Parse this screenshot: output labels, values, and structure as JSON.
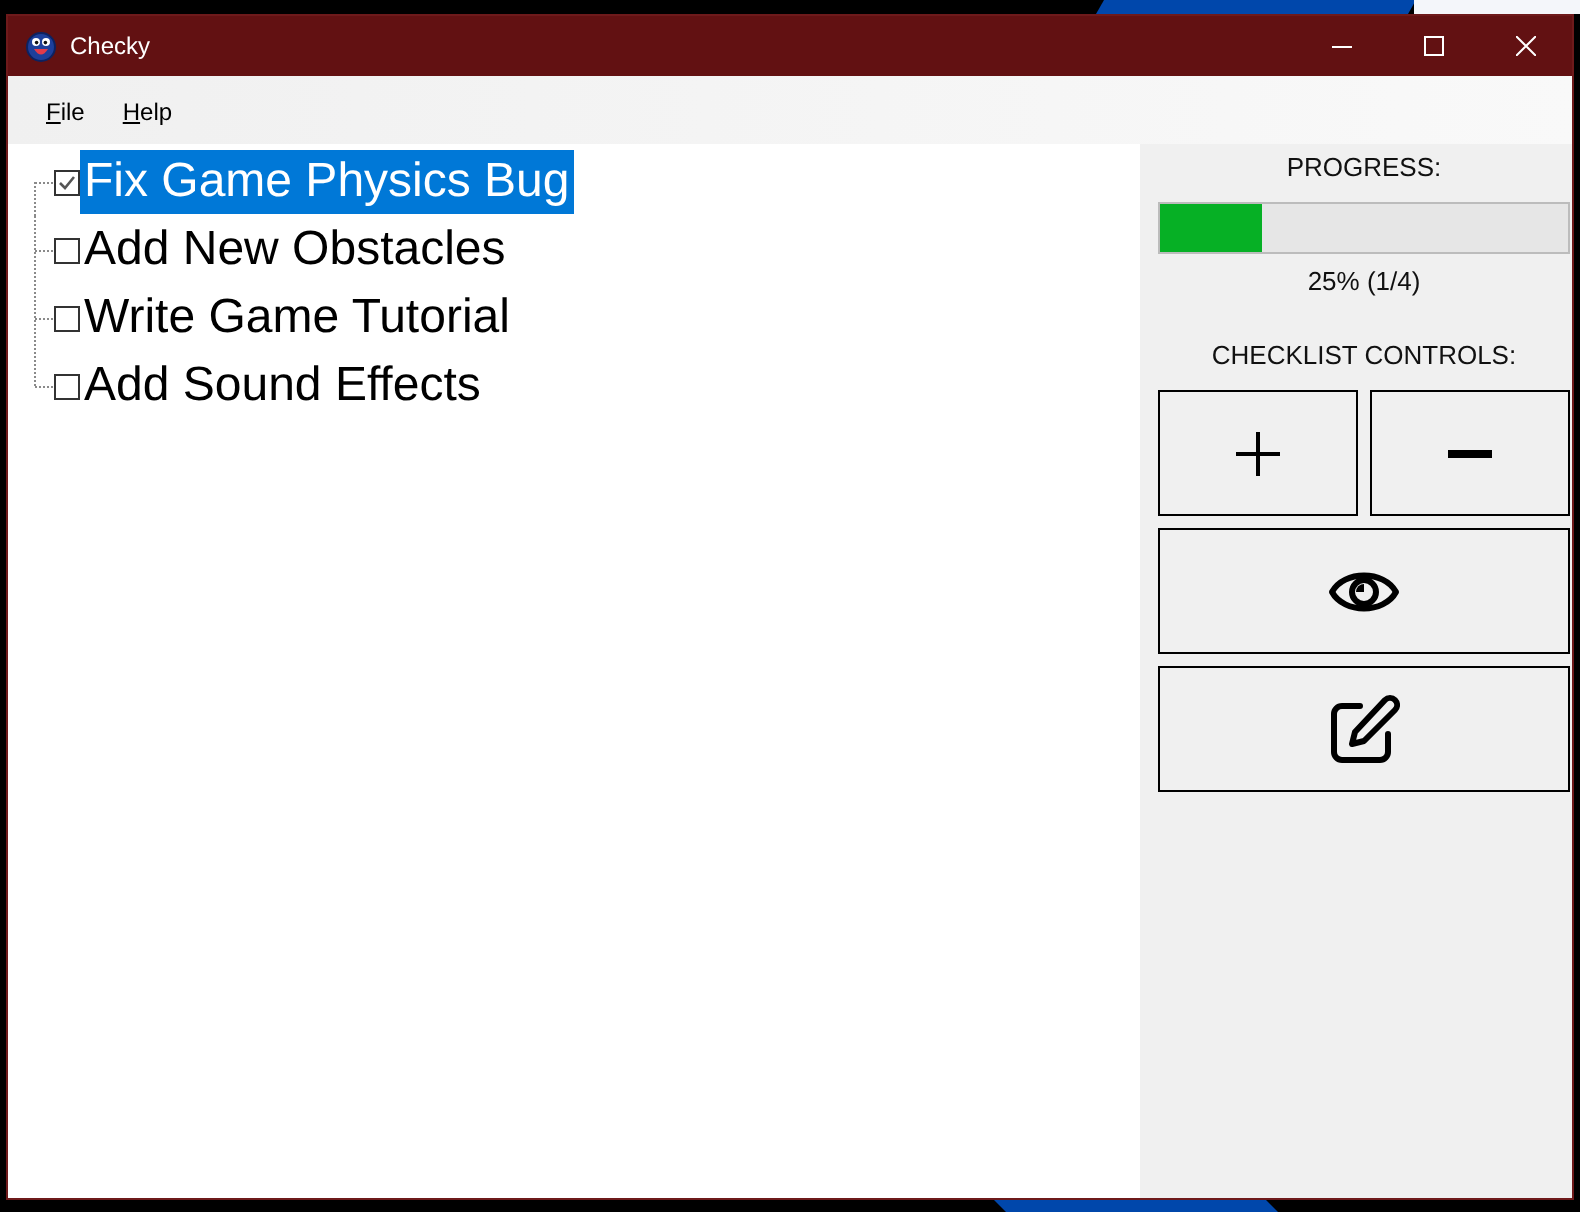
{
  "window": {
    "title": "Checky"
  },
  "menu": [
    {
      "label": "File"
    },
    {
      "label": "Help"
    }
  ],
  "checklist": [
    {
      "label": "Fix Game Physics Bug",
      "checked": true,
      "selected": true
    },
    {
      "label": "Add New Obstacles",
      "checked": false,
      "selected": false
    },
    {
      "label": "Write Game Tutorial",
      "checked": false,
      "selected": false
    },
    {
      "label": "Add Sound Effects",
      "checked": false,
      "selected": false
    }
  ],
  "progress": {
    "heading": "PROGRESS:",
    "level": 0.25,
    "reading": "25% (1/4)"
  },
  "controls": {
    "heading": "CHECKLIST CONTROLS:",
    "buttons": [
      {
        "kind": "add"
      },
      {
        "kind": "remove"
      },
      {
        "kind": "view"
      },
      {
        "kind": "edit"
      }
    ]
  }
}
